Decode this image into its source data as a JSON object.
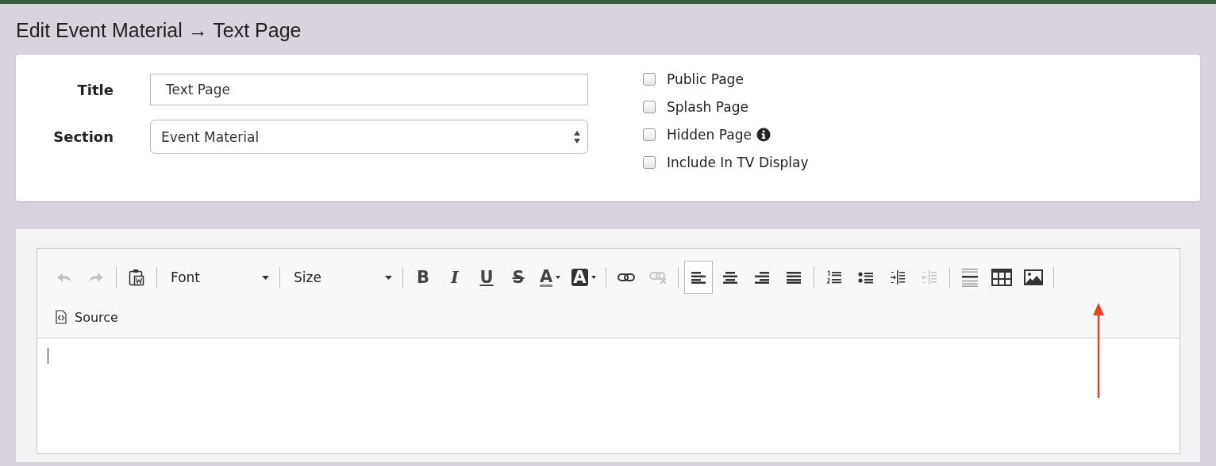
{
  "page_title": "Edit Event Material → Text Page",
  "form": {
    "fields": [
      {
        "kind": "text",
        "label": "Title",
        "value": "Text Page"
      },
      {
        "kind": "select",
        "label": "Section",
        "value": "Event Material"
      }
    ],
    "options": [
      {
        "label": "Public Page",
        "checked": false
      },
      {
        "label": "Splash Page",
        "checked": false
      },
      {
        "label": "Hidden Page",
        "checked": false,
        "info": true
      },
      {
        "label": "Include In TV Display",
        "checked": false
      }
    ]
  },
  "editor": {
    "toolbar_rows": [
      [
        {
          "kind": "undo",
          "disabled": true
        },
        {
          "kind": "redo",
          "disabled": true
        },
        {
          "kind": "separator"
        },
        {
          "kind": "paste-word",
          "disabled": false
        },
        {
          "kind": "separator"
        },
        {
          "kind": "combo",
          "label": "Font"
        },
        {
          "kind": "separator"
        },
        {
          "kind": "combo",
          "label": "Size"
        },
        {
          "kind": "separator"
        },
        {
          "kind": "bold",
          "label": "B",
          "disabled": false
        },
        {
          "kind": "italic",
          "label": "I",
          "disabled": false
        },
        {
          "kind": "underline",
          "label": "U",
          "disabled": false
        },
        {
          "kind": "strike",
          "label": "S",
          "disabled": false
        },
        {
          "kind": "text-color",
          "label": "A",
          "disabled": false
        },
        {
          "kind": "bg-color",
          "label": "A",
          "disabled": false
        },
        {
          "kind": "separator"
        },
        {
          "kind": "link",
          "disabled": false
        },
        {
          "kind": "unlink",
          "disabled": true
        },
        {
          "kind": "separator"
        },
        {
          "kind": "align-left",
          "selected": true
        },
        {
          "kind": "align-center",
          "selected": false
        },
        {
          "kind": "align-right",
          "selected": false
        },
        {
          "kind": "justify",
          "selected": false
        },
        {
          "kind": "separator"
        },
        {
          "kind": "numbered-list",
          "disabled": false
        },
        {
          "kind": "bullet-list",
          "disabled": false
        },
        {
          "kind": "indent",
          "disabled": false
        },
        {
          "kind": "outdent",
          "disabled": true
        },
        {
          "kind": "separator"
        },
        {
          "kind": "rule",
          "disabled": false
        },
        {
          "kind": "table",
          "disabled": false
        },
        {
          "kind": "image",
          "disabled": false
        },
        {
          "kind": "separator"
        }
      ],
      [
        {
          "kind": "source",
          "label": "Source",
          "disabled": false
        }
      ]
    ]
  }
}
